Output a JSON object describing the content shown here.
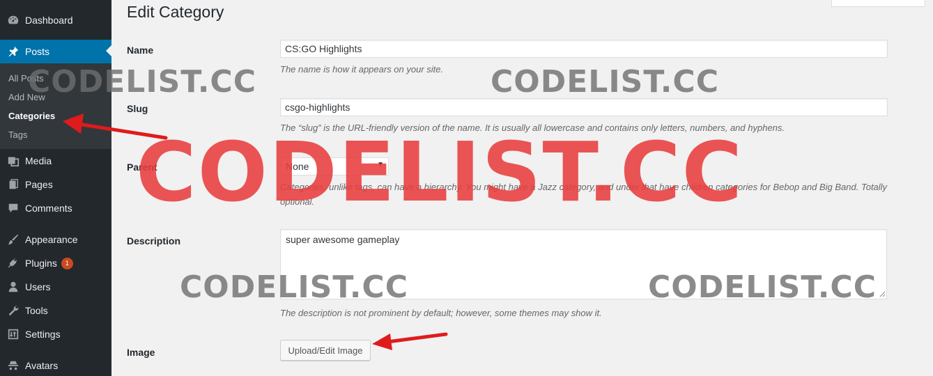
{
  "sidebar": {
    "menu": [
      {
        "label": "Dashboard",
        "icon": "dashboard-icon"
      },
      {
        "label": "Posts",
        "icon": "pin-icon"
      },
      {
        "label": "Media",
        "icon": "media-icon"
      },
      {
        "label": "Pages",
        "icon": "pages-icon"
      },
      {
        "label": "Comments",
        "icon": "comments-icon"
      },
      {
        "label": "Appearance",
        "icon": "brush-icon"
      },
      {
        "label": "Plugins",
        "icon": "plug-icon",
        "badge": "1"
      },
      {
        "label": "Users",
        "icon": "users-icon"
      },
      {
        "label": "Tools",
        "icon": "wrench-icon"
      },
      {
        "label": "Settings",
        "icon": "settings-icon"
      },
      {
        "label": "Avatars",
        "icon": "spy-icon"
      }
    ],
    "submenu": [
      "All Posts",
      "Add New",
      "Categories",
      "Tags"
    ]
  },
  "page": {
    "title": "Edit Category"
  },
  "form": {
    "name": {
      "label": "Name",
      "value": "CS:GO Highlights",
      "help": "The name is how it appears on your site."
    },
    "slug": {
      "label": "Slug",
      "value": "csgo-highlights",
      "help": "The “slug” is the URL-friendly version of the name. It is usually all lowercase and contains only letters, numbers, and hyphens."
    },
    "parent": {
      "label": "Parent",
      "value": "None",
      "help_line1": "Categories, unlike tags, can have a hierarchy. You might have a Jazz category, and under that have children categories for Bebop and Big Band. Totally",
      "help_line2": "optional."
    },
    "description": {
      "label": "Description",
      "value": "super awesome gameplay",
      "help": "The description is not prominent by default; however, some themes may show it."
    },
    "image": {
      "label": "Image",
      "button": "Upload/Edit Image"
    }
  },
  "watermark": {
    "text": "CODELIST.CC"
  },
  "colors": {
    "sidebar": "#23282d",
    "active": "#0073aa",
    "badge": "#ca4a1f",
    "watermark": "#e83c3c",
    "arrow": "#e01b1b"
  }
}
